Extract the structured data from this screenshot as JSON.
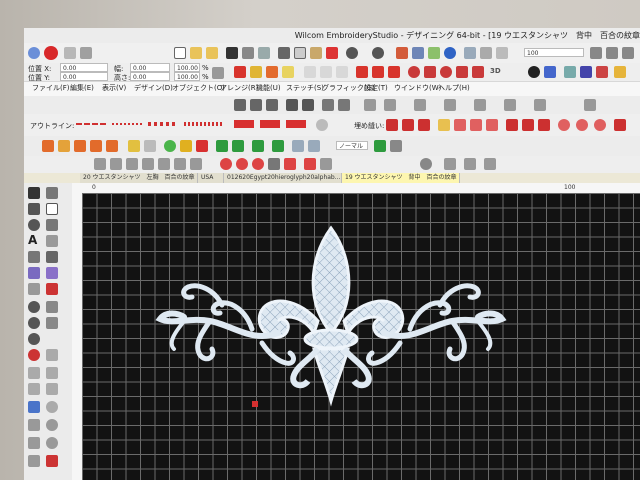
{
  "window": {
    "title": "Wilcom EmbroideryStudio - デザイニング 64-bit - [19 ウエスタンシャツ　背中　百合の紋章"
  },
  "position": {
    "x_label": "位置 X:",
    "y_label": "位置 Y:",
    "w_label": "幅:",
    "h_label": "高さ:",
    "x_value": "0.00",
    "y_value": "0.00",
    "w_value": "0.00",
    "h_value": "0.00",
    "pct_1": "100.00",
    "pct_2": "100.00",
    "pct_sym_1": "%",
    "pct_sym_2": "%"
  },
  "zoom": {
    "value": "100"
  },
  "menu": [
    "ファイル(F)",
    "編集(E)",
    "表示(V)",
    "デザイン(D)",
    "オブジェクト(O)",
    "アレンジ(R)",
    "機能(U)",
    "ステッチ(S)",
    "グラフィック(G)",
    "設定(T)",
    "ウインドウ(W)",
    "ヘルプ(H)"
  ],
  "toolbar": {
    "outline_label": "アウトライン:",
    "fill_label": "埋め縫い:",
    "three_d_label": "3D",
    "norm_label": "ノーマル"
  },
  "tabs": [
    "20 ウエスタンシャツ　左胸　百合の紋章",
    "USA",
    "012620Egypt20hieroglyph20alphab...",
    "19 ウエスタンシャツ　背中　百合の紋章"
  ],
  "ruler": {
    "top_first": "0",
    "top_mark": "100"
  },
  "colors": {
    "canvas_bg": "#121212",
    "grid": "#6a6a6a",
    "active_tab": "#fdf6b0",
    "stitch": "#dfe9f2"
  },
  "icons": [
    "home-icon",
    "w-logo-icon",
    "new-icon",
    "open-icon",
    "save-icon",
    "print-icon",
    "cut-icon",
    "copy-icon",
    "paste-icon",
    "undo-icon",
    "redo-icon",
    "info-icon",
    "select-arrow-icon",
    "text-icon",
    "fleur-de-lis-design"
  ]
}
